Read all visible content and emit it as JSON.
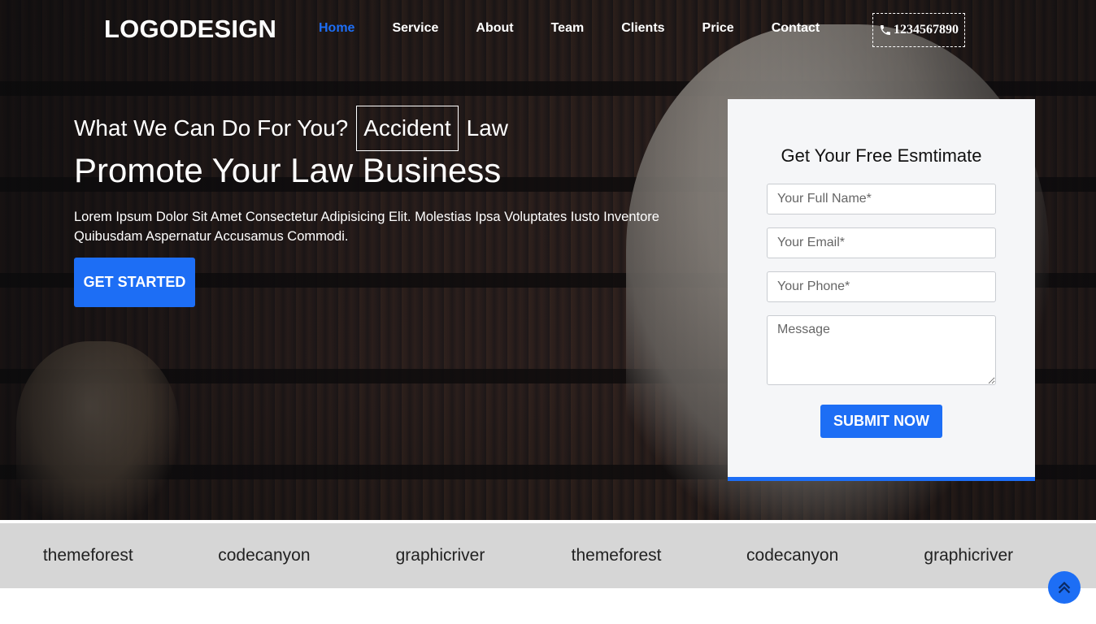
{
  "header": {
    "logo": "LOGODESIGN",
    "nav": [
      {
        "label": "Home",
        "active": true
      },
      {
        "label": "Service"
      },
      {
        "label": "About"
      },
      {
        "label": "Team"
      },
      {
        "label": "Clients"
      },
      {
        "label": "Price"
      },
      {
        "label": "Contact"
      }
    ],
    "phone": "1234567890",
    "phone_icon": "phone-icon"
  },
  "hero": {
    "tagline_prefix": "What We Can Do For You?",
    "rotating_word": "Accident",
    "tagline_suffix": "Law",
    "title": "Promote Your Law Business",
    "lead": "Lorem Ipsum Dolor Sit Amet Consectetur Adipisicing Elit. Molestias Ipsa Voluptates Iusto Inventore Quibusdam Aspernatur Accusamus Commodi.",
    "cta_label": "GET STARTED"
  },
  "estimate_form": {
    "title": "Get Your Free Esmtimate",
    "name_placeholder": "Your Full Name*",
    "email_placeholder": "Your Email*",
    "phone_placeholder": "Your Phone*",
    "message_placeholder": "Message",
    "submit_label": "SUBMIT NOW"
  },
  "brands": [
    "themeforest",
    "codecanyon",
    "graphicriver",
    "themeforest",
    "codecanyon",
    "graphicriver"
  ],
  "scroll_top_icon": "double-chevron-up-icon",
  "colors": {
    "accent": "#1d6ef5",
    "brands_bg": "#d6d6d6",
    "card_bg": "#f5f6f8"
  }
}
